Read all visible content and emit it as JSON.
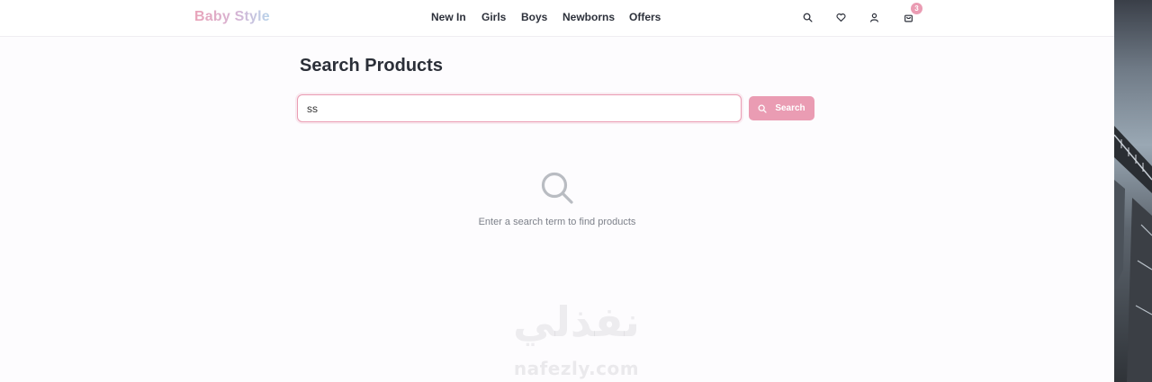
{
  "header": {
    "logo": "Baby Style",
    "nav": [
      "New In",
      "Girls",
      "Boys",
      "Newborns",
      "Offers"
    ],
    "cart_count": "3",
    "icons": [
      "search-icon",
      "heart-icon",
      "user-icon",
      "shopping-bag-icon"
    ]
  },
  "main": {
    "title": "Search Products",
    "search_value": "ss",
    "search_button_label": "Search",
    "empty_message": "Enter a search term to find products"
  },
  "watermark": {
    "arabic": "نفذلي",
    "latin": "nafezly.com"
  },
  "colors": {
    "accent": "#ea9cb3",
    "text_dark": "#2b2f38",
    "muted": "#7d818a"
  }
}
